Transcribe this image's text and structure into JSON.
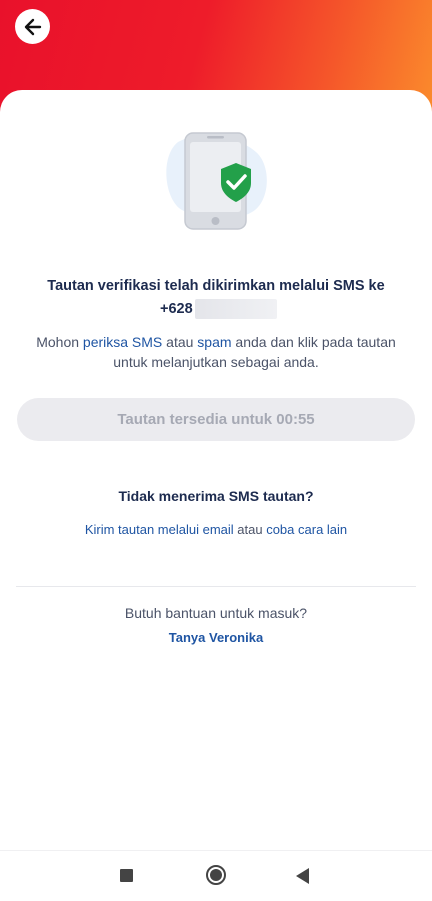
{
  "header": {
    "back_icon": "arrow-left-icon",
    "colors": {
      "gradient_start": "#e9112b",
      "gradient_end": "#fb8d2c"
    }
  },
  "illustration": {
    "icon": "phone-shield-check-icon",
    "colors": {
      "shield": "#23a04a",
      "phone": "#d9dce2",
      "blob": "#e8f1fb"
    }
  },
  "message": {
    "title": "Tautan verifikasi telah dikirimkan melalui SMS ke",
    "phone_prefix": "+628",
    "body_before": "Mohon ",
    "body_link1": "periksa SMS",
    "body_mid1": " atau ",
    "body_link2": "spam",
    "body_after": " anda dan klik pada tautan untuk melanjutkan sebagai anda."
  },
  "timer_button": {
    "label": "Tautan tersedia untuk 00:55"
  },
  "no_sms": {
    "heading": "Tidak menerima SMS tautan?",
    "link_email": "Kirim tautan melalui email",
    "separator": " atau ",
    "link_other": "coba cara lain"
  },
  "help": {
    "question": "Butuh bantuan untuk masuk?",
    "link": "Tanya Veronika"
  },
  "colors": {
    "primary_text": "#1d2b4f",
    "link": "#1f55a3",
    "disabled_bg": "#ebebef"
  },
  "nav": {
    "recent_icon": "square-icon",
    "home_icon": "circle-icon",
    "back_icon": "triangle-back-icon"
  }
}
